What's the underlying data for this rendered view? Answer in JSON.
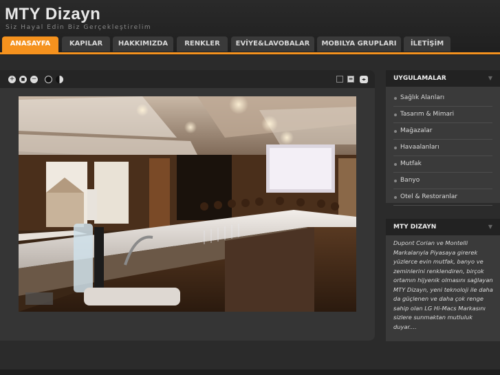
{
  "header": {
    "title": "MTY Dizayn",
    "subtitle": "Siz Hayal Edin Biz Gerçekleştirelim"
  },
  "nav": {
    "items": [
      {
        "label": "ANASAYFA"
      },
      {
        "label": "KAPILAR"
      },
      {
        "label": "HAKKIMIZDA"
      },
      {
        "label": "RENKLER"
      },
      {
        "label": "EVİYE&LAVOBALAR"
      },
      {
        "label": "MOBILYA GRUPLARI"
      },
      {
        "label": "İLETİŞİM"
      }
    ],
    "active": "ANASAYFA",
    "accent_color": "#f5921e"
  },
  "viewer": {
    "left_controls": [
      "zoom-in-icon",
      "stop-icon",
      "zoom-out-icon",
      "dark-theme-icon",
      "half-theme-icon"
    ],
    "right_controls": [
      "fullscreen-icon",
      "thumbnails-icon",
      "nav-arrows-icon"
    ],
    "control_glyphs": {
      "zoom_in": "+",
      "stop": "■",
      "zoom_out": "−",
      "thumbnails": "≡",
      "nav": "◂▸"
    }
  },
  "sidebar": {
    "applications": {
      "title": "UYGULAMALAR",
      "items": [
        {
          "label": "Sağlık Alanları"
        },
        {
          "label": "Tasarım & Mimari"
        },
        {
          "label": "Mağazalar"
        },
        {
          "label": "Havaalanları"
        },
        {
          "label": "Mutfak"
        },
        {
          "label": "Banyo"
        },
        {
          "label": "Otel & Restoranlar"
        }
      ]
    },
    "about": {
      "title": "MTY DIZAYN",
      "text": "Dupont Corian ve Montelli Markalarıyla Piyasaya girerek yüzlerce evin mutfak, banyo ve zeminlerini renklendiren, birçok ortamın hijyenik olmasını sağlayan MTY Dizayn, yeni teknoloji ile daha da güçlenen ve daha çok renge sahip olan LG Hi-Macs Markasını sizlere sunmaktan mutluluk duyar...."
    }
  }
}
